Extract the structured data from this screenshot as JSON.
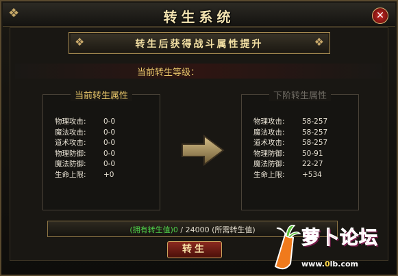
{
  "window": {
    "title": "转生系统",
    "close_glyph": "✕"
  },
  "banner": {
    "text": "转生后获得战斗属性提升"
  },
  "level": {
    "label": "当前转生等级："
  },
  "current_panel": {
    "title": "当前转生属性",
    "title_color": "#e8c66a",
    "stats": [
      {
        "name": "物理攻击:",
        "value": "0-0"
      },
      {
        "name": "魔法攻击:",
        "value": "0-0"
      },
      {
        "name": "道术攻击:",
        "value": "0-0"
      },
      {
        "name": "物理防御:",
        "value": "0-0"
      },
      {
        "name": "魔法防御:",
        "value": "0-0"
      },
      {
        "name": "生命上限:",
        "value": "+0"
      }
    ]
  },
  "next_panel": {
    "title": "下阶转生属性",
    "title_color": "#6f6b63",
    "stats": [
      {
        "name": "物理攻击:",
        "value": "58-257"
      },
      {
        "name": "魔法攻击:",
        "value": "58-257"
      },
      {
        "name": "道术攻击:",
        "value": "58-257"
      },
      {
        "name": "物理防御:",
        "value": "50-91"
      },
      {
        "name": "魔法防御:",
        "value": "22-27"
      },
      {
        "name": "生命上限:",
        "value": "+534"
      }
    ]
  },
  "progress": {
    "have_text": "(拥有转生值)0",
    "rest_text": " / 24000 (所需转生值)",
    "fraction": 0
  },
  "rebirth_button": {
    "label": "转生"
  },
  "watermark": {
    "brand": "萝卜论坛",
    "url_prefix": "www.",
    "url_mid": "0",
    "url_suffix": "lb.com"
  },
  "colors": {
    "accent_gold": "#e8c66a",
    "have_green": "#4fd24a",
    "button_red": "#8b2a1f"
  },
  "icons": {
    "arrow": "arrow-right-icon",
    "close": "close-icon"
  }
}
